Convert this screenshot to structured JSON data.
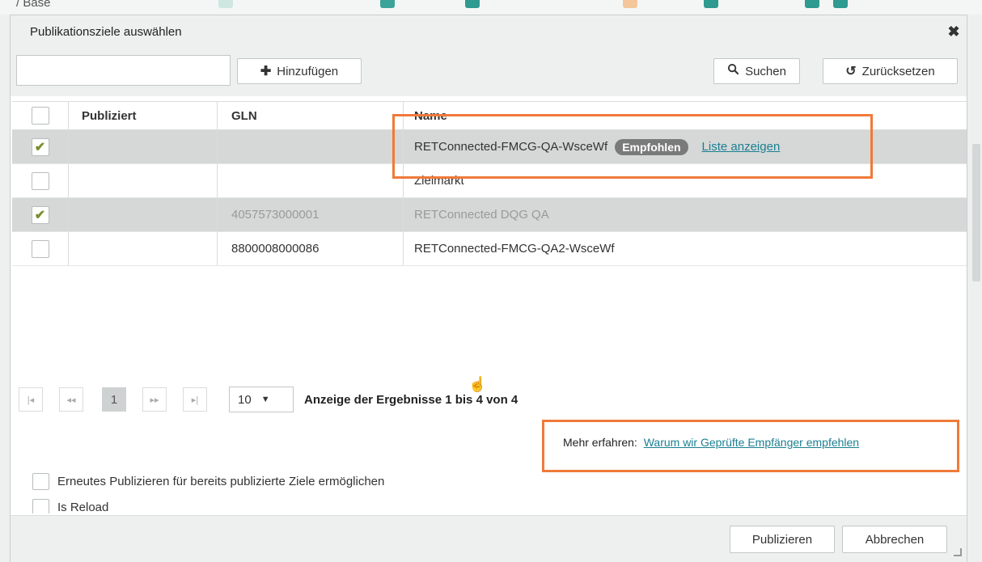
{
  "background": {
    "app_title_fragment": "/ Base"
  },
  "dialog": {
    "title": "Publikationsziele auswählen",
    "close_glyph": "✖",
    "icons": {
      "close": "close-icon",
      "add": "plus-icon",
      "search": "search-icon",
      "reset": "reset-icon"
    }
  },
  "toolbar": {
    "search_value": "",
    "add_label": "Hinzufügen",
    "search_label": "Suchen",
    "reset_label": "Zurücksetzen"
  },
  "table": {
    "columns": [
      "",
      "Publiziert",
      "GLN",
      "Name"
    ],
    "rows": [
      {
        "checked": true,
        "publiziert": "",
        "gln": "",
        "name": "RETConnected-FMCG-QA-WsceWf",
        "badge": "Empfohlen",
        "link": "Liste anzeigen",
        "selected": true,
        "muted": false
      },
      {
        "checked": false,
        "publiziert": "",
        "gln": "",
        "name": "Zielmarkt",
        "selected": false,
        "muted": false
      },
      {
        "checked": true,
        "publiziert": "",
        "gln": "4057573000001",
        "name": "RETConnected DQG QA",
        "selected": true,
        "muted": true
      },
      {
        "checked": false,
        "publiziert": "",
        "gln": "8800008000086",
        "name": "RETConnected-FMCG-QA2-WsceWf",
        "selected": false,
        "muted": false
      }
    ]
  },
  "pager": {
    "current_page": "1",
    "page_size": "10",
    "info": "Anzeige der Ergebnisse 1 bis 4 von 4"
  },
  "learn_more": {
    "prefix": "Mehr erfahren:",
    "link": "Warum wir Geprüfte Empfänger empfehlen"
  },
  "options": {
    "republish_label": "Erneutes Publizieren für bereits publizierte Ziele ermöglichen",
    "reload_label": "Is Reload"
  },
  "footer": {
    "publish_label": "Publizieren",
    "cancel_label": "Abbrechen"
  },
  "colors": {
    "highlight": "#f07a3a",
    "link": "#1b7f92",
    "check": "#7a8f2a",
    "badge": "#7a7a7a",
    "selected_row": "#d6d8d8"
  }
}
